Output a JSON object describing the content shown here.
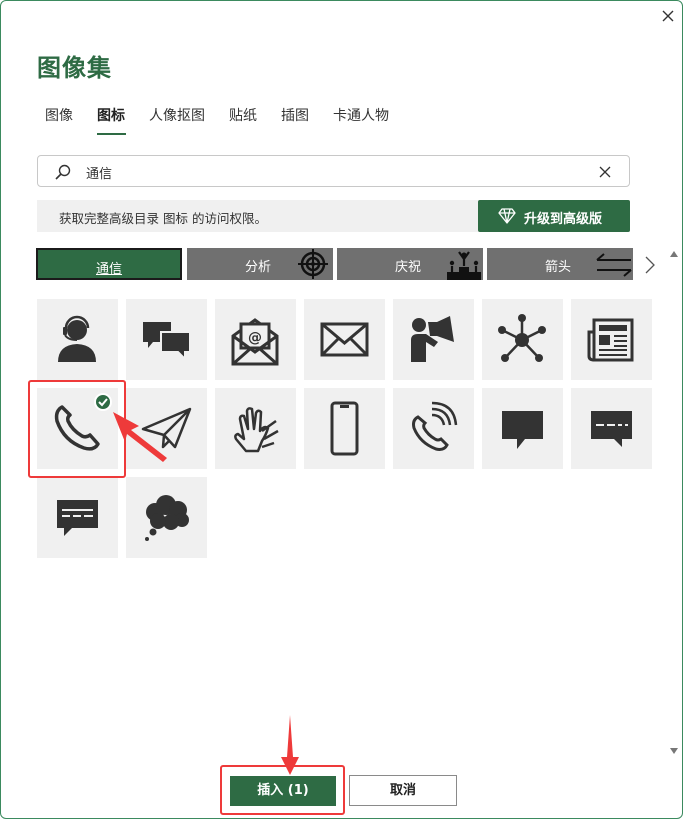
{
  "dialog": {
    "title": "图像集",
    "close_icon": "close-icon"
  },
  "tabs": [
    {
      "label": "图像",
      "active": false
    },
    {
      "label": "图标",
      "active": true
    },
    {
      "label": "人像抠图",
      "active": false
    },
    {
      "label": "贴纸",
      "active": false
    },
    {
      "label": "插图",
      "active": false
    },
    {
      "label": "卡通人物",
      "active": false
    }
  ],
  "search": {
    "value": "通信",
    "placeholder": ""
  },
  "notice": {
    "text": "获取完整高级目录 图标 的访问权限。",
    "upgrade_label": "升级到高级版"
  },
  "categories": [
    {
      "label": "通信",
      "active": true,
      "icon": ""
    },
    {
      "label": "分析",
      "active": false,
      "icon": "target-icon"
    },
    {
      "label": "庆祝",
      "active": false,
      "icon": "podium-icon"
    },
    {
      "label": "箭头",
      "active": false,
      "icon": "swap-arrows-icon"
    }
  ],
  "icons": [
    {
      "name": "headset-person-icon",
      "selected": false
    },
    {
      "name": "chat-bubbles-icon",
      "selected": false
    },
    {
      "name": "open-email-icon",
      "selected": false
    },
    {
      "name": "envelope-icon",
      "selected": false
    },
    {
      "name": "megaphone-person-icon",
      "selected": false
    },
    {
      "name": "network-hub-icon",
      "selected": false
    },
    {
      "name": "newspaper-icon",
      "selected": false
    },
    {
      "name": "phone-handset-icon",
      "selected": true
    },
    {
      "name": "paper-plane-icon",
      "selected": false
    },
    {
      "name": "sign-language-icon",
      "selected": false
    },
    {
      "name": "mobile-phone-icon",
      "selected": false
    },
    {
      "name": "phone-ringing-icon",
      "selected": false
    },
    {
      "name": "speech-bubble-icon",
      "selected": false
    },
    {
      "name": "message-bubble-icon",
      "selected": false
    },
    {
      "name": "message-bubble-dashes-icon",
      "selected": false
    },
    {
      "name": "thought-cloud-icon",
      "selected": false
    }
  ],
  "footer": {
    "insert_label": "插入 (1)",
    "cancel_label": "取消"
  },
  "colors": {
    "accent": "#2e6b44",
    "category_inactive": "#707070",
    "tile_bg": "#f0f0f0",
    "annotation": "#ee3a3a"
  }
}
